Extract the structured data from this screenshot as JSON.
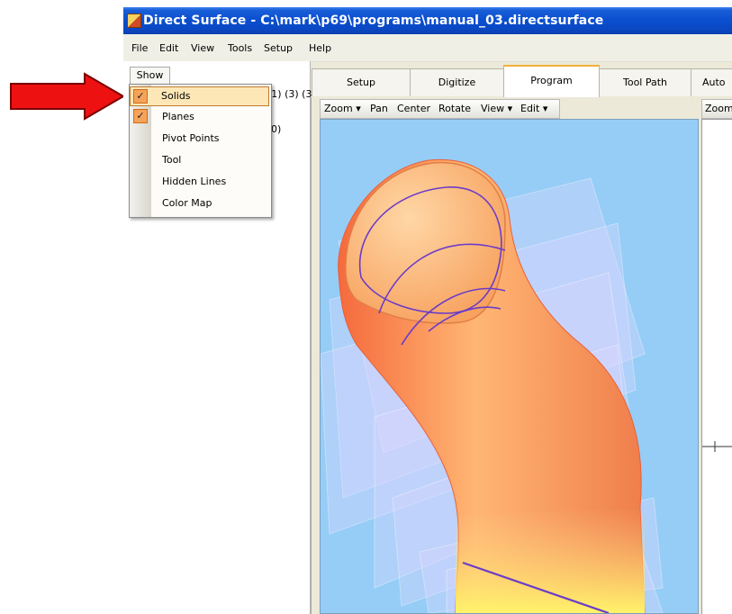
{
  "window": {
    "title": "Direct Surface - C:\\mark\\p69\\programs\\manual_03.directsurface"
  },
  "menubar": {
    "items": [
      "File",
      "Edit",
      "View",
      "Tools",
      "Setup",
      "Help"
    ]
  },
  "left_panel": {
    "show_tab": "Show",
    "tree_line1": "(1) (3) (3",
    "tree_line2": "10)",
    "tree_line3": ")"
  },
  "show_menu": {
    "items": [
      {
        "label": "Solids",
        "checked": true,
        "highlighted": true
      },
      {
        "label": "Planes",
        "checked": true,
        "highlighted": false
      },
      {
        "label": "Pivot Points",
        "checked": false,
        "highlighted": false
      },
      {
        "label": "Tool",
        "checked": false,
        "highlighted": false
      },
      {
        "label": "Hidden Lines",
        "checked": false,
        "highlighted": false
      },
      {
        "label": "Color Map",
        "checked": false,
        "highlighted": false
      }
    ]
  },
  "tabs": {
    "items": [
      "Setup",
      "Digitize",
      "Program",
      "Tool Path",
      "Auto"
    ],
    "active": "Program"
  },
  "viewport_toolbar": {
    "zoom": "Zoom",
    "pan": "Pan",
    "center": "Center",
    "rotate": "Rotate",
    "view": "View",
    "edit": "Edit",
    "dropdown_glyph": "▾"
  },
  "viewport2_toolbar": {
    "zoom": "Zoom"
  },
  "icons": {
    "checkmark": "✓",
    "arrow_annotation": "red-arrow-icon"
  },
  "colors": {
    "titlebar": "#0b4fd0",
    "viewport_bg": "#96cdf6",
    "menu_highlight": "#fde7b7",
    "check_bg": "#f5a25a",
    "arrow": "#ff0000"
  }
}
